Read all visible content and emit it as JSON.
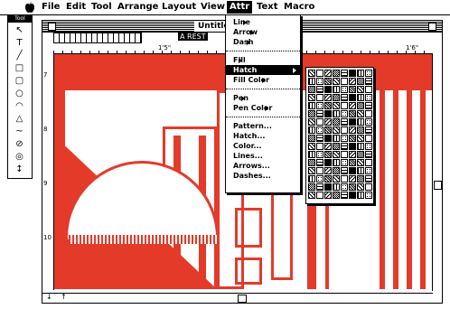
{
  "menubar": {
    "apple_icon": "apple-logo",
    "items": [
      "File",
      "Edit",
      "Tool",
      "Arrange",
      "Layout",
      "View",
      "Attr",
      "Text",
      "Macro"
    ],
    "active": "Attr"
  },
  "toolbox": {
    "title": "Tool",
    "tools": [
      "arrow",
      "T",
      "line",
      "rect",
      "rounded-rect",
      "oval",
      "arc",
      "polygon",
      "freehand",
      "stamp",
      "circle",
      "dimension",
      "scale",
      "ruler"
    ]
  },
  "window": {
    "title": "Untitled",
    "zoom_label": "A REST",
    "ruler_labels": [
      "1'5\"",
      "1'6\""
    ],
    "vruler_labels": [
      "7",
      "8",
      "9",
      "10"
    ]
  },
  "attr_menu": {
    "items": [
      {
        "label": "Line",
        "submenu": true
      },
      {
        "label": "Arrow",
        "submenu": true
      },
      {
        "label": "Dash",
        "submenu": true
      },
      {
        "sep": true
      },
      {
        "label": "Fill",
        "submenu": true
      },
      {
        "label": "Hatch",
        "submenu": true,
        "highlighted": true
      },
      {
        "label": "Fill Color",
        "submenu": true
      },
      {
        "sep": true
      },
      {
        "label": "Pen",
        "submenu": true
      },
      {
        "label": "Pen Color",
        "submenu": true
      },
      {
        "sep": true
      },
      {
        "label": "Pattern..."
      },
      {
        "label": "Hatch..."
      },
      {
        "label": "Color..."
      },
      {
        "label": "Lines..."
      },
      {
        "label": "Arrows..."
      },
      {
        "label": "Dashes..."
      }
    ]
  },
  "colors": {
    "accent_red": "#e43a2a",
    "menu_highlight": "#000000"
  },
  "hatch_palette": {
    "columns": 8,
    "rows": 16
  }
}
